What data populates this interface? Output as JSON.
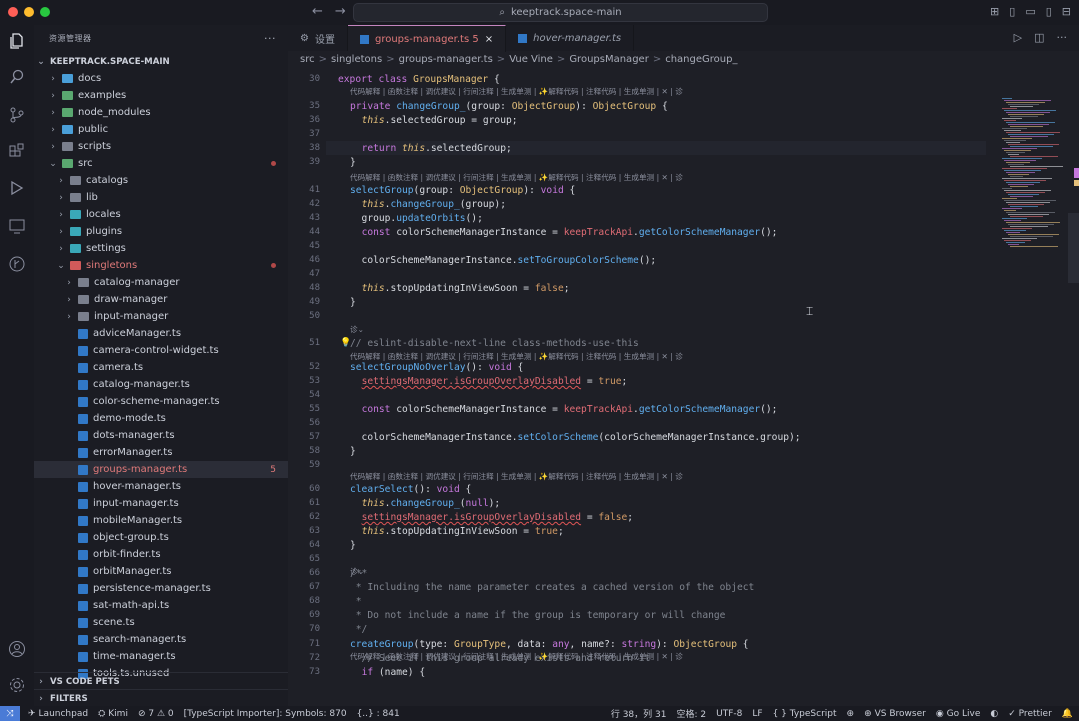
{
  "window": {
    "search_text": "keeptrack.space-main",
    "search_icon": "search-icon"
  },
  "sidebar": {
    "title": "资源管理器",
    "more": "···",
    "root": "KEEPTRACK.SPACE-MAIN",
    "items": [
      {
        "label": "docs",
        "kind": "folder-blue",
        "depth": 1,
        "open": false
      },
      {
        "label": "examples",
        "kind": "folder-green",
        "depth": 1,
        "open": false
      },
      {
        "label": "node_modules",
        "kind": "folder-green",
        "depth": 1,
        "open": false
      },
      {
        "label": "public",
        "kind": "folder-blue",
        "depth": 1,
        "open": false
      },
      {
        "label": "scripts",
        "kind": "folder",
        "depth": 1,
        "open": false
      },
      {
        "label": "src",
        "kind": "folder-green",
        "depth": 1,
        "open": true,
        "dot": true
      },
      {
        "label": "catalogs",
        "kind": "folder",
        "depth": 2,
        "open": false
      },
      {
        "label": "lib",
        "kind": "folder",
        "depth": 2,
        "open": false
      },
      {
        "label": "locales",
        "kind": "folder-teal",
        "depth": 2,
        "open": false
      },
      {
        "label": "plugins",
        "kind": "folder-teal",
        "depth": 2,
        "open": false
      },
      {
        "label": "settings",
        "kind": "folder-teal",
        "depth": 2,
        "open": false
      },
      {
        "label": "singletons",
        "kind": "folder-red",
        "depth": 2,
        "open": true,
        "dot": true,
        "red": true
      },
      {
        "label": "catalog-manager",
        "kind": "folder",
        "depth": 3,
        "open": false
      },
      {
        "label": "draw-manager",
        "kind": "folder",
        "depth": 3,
        "open": false
      },
      {
        "label": "input-manager",
        "kind": "folder",
        "depth": 3,
        "open": false
      },
      {
        "label": "adviceManager.ts",
        "kind": "ts",
        "depth": 3
      },
      {
        "label": "camera-control-widget.ts",
        "kind": "ts",
        "depth": 3
      },
      {
        "label": "camera.ts",
        "kind": "ts",
        "depth": 3
      },
      {
        "label": "catalog-manager.ts",
        "kind": "ts",
        "depth": 3
      },
      {
        "label": "color-scheme-manager.ts",
        "kind": "ts",
        "depth": 3
      },
      {
        "label": "demo-mode.ts",
        "kind": "ts",
        "depth": 3
      },
      {
        "label": "dots-manager.ts",
        "kind": "ts",
        "depth": 3
      },
      {
        "label": "errorManager.ts",
        "kind": "ts",
        "depth": 3
      },
      {
        "label": "groups-manager.ts",
        "kind": "ts",
        "depth": 3,
        "active": true,
        "badge": "5",
        "red": true
      },
      {
        "label": "hover-manager.ts",
        "kind": "ts",
        "depth": 3
      },
      {
        "label": "input-manager.ts",
        "kind": "ts",
        "depth": 3
      },
      {
        "label": "mobileManager.ts",
        "kind": "ts",
        "depth": 3
      },
      {
        "label": "object-group.ts",
        "kind": "ts",
        "depth": 3
      },
      {
        "label": "orbit-finder.ts",
        "kind": "ts",
        "depth": 3
      },
      {
        "label": "orbitManager.ts",
        "kind": "ts",
        "depth": 3
      },
      {
        "label": "persistence-manager.ts",
        "kind": "ts",
        "depth": 3
      },
      {
        "label": "sat-math-api.ts",
        "kind": "ts",
        "depth": 3
      },
      {
        "label": "scene.ts",
        "kind": "ts",
        "depth": 3
      },
      {
        "label": "search-manager.ts",
        "kind": "ts",
        "depth": 3
      },
      {
        "label": "time-manager.ts",
        "kind": "ts",
        "depth": 3
      },
      {
        "label": "tools.ts.unused",
        "kind": "ts",
        "depth": 3
      }
    ],
    "sections": [
      "VS CODE PETS",
      "FILTERS"
    ]
  },
  "tabs": [
    {
      "label": "设置",
      "active": false
    },
    {
      "label": "groups-manager.ts 5",
      "active": true,
      "close": "×"
    },
    {
      "label": "hover-manager.ts",
      "active": false,
      "italic": true
    }
  ],
  "breadcrumbs": [
    "src",
    ">",
    "singletons",
    ">",
    "groups-manager.ts",
    ">",
    "Vue Vine",
    ">",
    "GroupsManager",
    ">",
    "changeGroup_"
  ],
  "code": {
    "hint_full": "代码解释 | 函数注释 | 调优建议 | 行间注释 | 生成单测 | ✨解释代码 | 注释代码 | 生成单测 | ✕ | 诊",
    "hint_short": "诊⌄",
    "lines": [
      {
        "n": "30",
        "t": "export class GroupsManager {"
      },
      {
        "n": "35",
        "t": "private changeGroup_(group: ObjectGroup): ObjectGroup {"
      },
      {
        "n": "36",
        "t": "  this.selectedGroup = group;"
      },
      {
        "n": "37",
        "t": ""
      },
      {
        "n": "38",
        "t": "  return this.selectedGroup;"
      },
      {
        "n": "39",
        "t": "}"
      },
      {
        "n": "41",
        "t": "selectGroup(group: ObjectGroup): void {"
      },
      {
        "n": "42",
        "t": "  this.changeGroup_(group);"
      },
      {
        "n": "43",
        "t": "  group.updateOrbits();"
      },
      {
        "n": "44",
        "t": "  const colorSchemeManagerInstance = keepTrackApi.getColorSchemeManager();"
      },
      {
        "n": "45",
        "t": ""
      },
      {
        "n": "46",
        "t": "  colorSchemeManagerInstance.setToGroupColorScheme();"
      },
      {
        "n": "47",
        "t": ""
      },
      {
        "n": "48",
        "t": "  this.stopUpdatingInViewSoon = false;"
      },
      {
        "n": "49",
        "t": "}"
      },
      {
        "n": "50",
        "t": ""
      },
      {
        "n": "51",
        "t": "// eslint-disable-next-line class-methods-use-this"
      },
      {
        "n": "52",
        "t": "selectGroupNoOverlay(): void {"
      },
      {
        "n": "53",
        "t": "  settingsManager.isGroupOverlayDisabled = true;"
      },
      {
        "n": "54",
        "t": ""
      },
      {
        "n": "55",
        "t": "  const colorSchemeManagerInstance = keepTrackApi.getColorSchemeManager();"
      },
      {
        "n": "56",
        "t": ""
      },
      {
        "n": "57",
        "t": "  colorSchemeManagerInstance.setColorScheme(colorSchemeManagerInstance.group);"
      },
      {
        "n": "58",
        "t": "}"
      },
      {
        "n": "59",
        "t": ""
      },
      {
        "n": "60",
        "t": "clearSelect(): void {"
      },
      {
        "n": "61",
        "t": "  this.changeGroup_(null);"
      },
      {
        "n": "62",
        "t": "  settingsManager.isGroupOverlayDisabled = false;"
      },
      {
        "n": "63",
        "t": "  this.stopUpdatingInViewSoon = true;"
      },
      {
        "n": "64",
        "t": "}"
      },
      {
        "n": "65",
        "t": ""
      },
      {
        "n": "66",
        "t": "/**"
      },
      {
        "n": "67",
        "t": " * Including the name parameter creates a cached version of the object"
      },
      {
        "n": "68",
        "t": " *"
      },
      {
        "n": "69",
        "t": " * Do not include a name if the group is temporary or will change"
      },
      {
        "n": "70",
        "t": " */"
      },
      {
        "n": "71",
        "t": "createGroup(type: GroupType, data: any, name?: string): ObjectGroup {"
      },
      {
        "n": "72",
        "t": "  // Seee if this group already exists and return it"
      },
      {
        "n": "73",
        "t": "  if (name) {"
      }
    ]
  },
  "statusbar": {
    "launchpad": "Launchpad",
    "kimi": "Kimi",
    "problems": "⊘ 7 ⚠ 0",
    "ts_importer": "[TypeScript Importer]: Symbols: 870",
    "selection": "{..} : 841",
    "position": "行 38，列 31",
    "spaces": "空格: 2",
    "encoding": "UTF-8",
    "eol": "LF",
    "language": "{ } TypeScript",
    "vsbrowser": "VS Browser",
    "golive": "Go Live",
    "prettier": "✓ Prettier"
  },
  "colors": {
    "accent": "#c586c0",
    "ts_blue": "#3178c6",
    "error_red": "#e07a7a",
    "remote_blue": "#4a7bd6"
  }
}
